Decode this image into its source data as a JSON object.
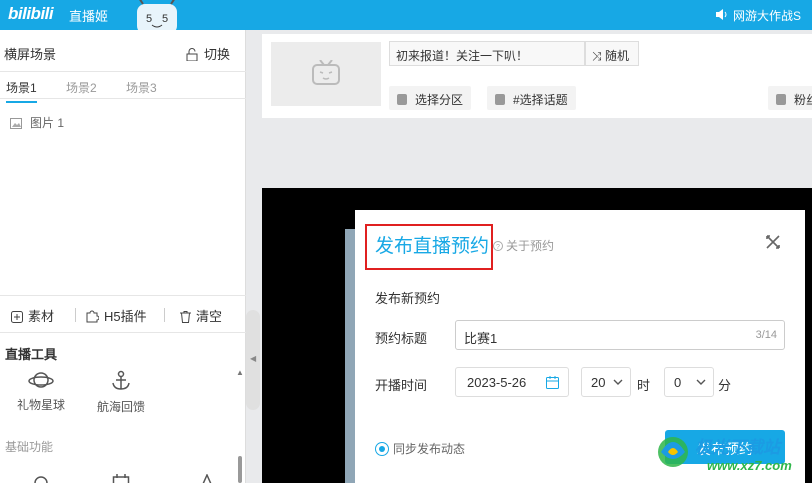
{
  "topbar": {
    "logo": "bilibili",
    "app_name": "直播姬",
    "notice": "网游大作战S"
  },
  "scenes": {
    "title": "横屏场景",
    "switch_label": "切换",
    "tabs": [
      {
        "label": "场景1",
        "active": true
      },
      {
        "label": "场景2",
        "active": false
      },
      {
        "label": "场景3",
        "active": false
      }
    ],
    "sources": [
      {
        "label": "图片 1",
        "icon": "image-icon"
      }
    ]
  },
  "toolbar": {
    "material_label": "素材",
    "h5_label": "H5插件",
    "clear_label": "清空"
  },
  "live_tools": {
    "title": "直播工具",
    "items": [
      {
        "label": "礼物星球",
        "icon": "planet-icon"
      },
      {
        "label": "航海回馈",
        "icon": "anchor-icon"
      }
    ]
  },
  "basic": {
    "title": "基础功能"
  },
  "room_info": {
    "title_text": "初来报道！关注一下叭！",
    "random_label": "随机",
    "select_area_label": "选择分区",
    "select_topic_label": "#选择话题",
    "fans_label": "粉丝"
  },
  "modal": {
    "title": "发布直播预约",
    "help_label": "关于预约",
    "section_label": "发布新预约",
    "title_label": "预约标题",
    "title_value": "比赛1",
    "title_count": "3/14",
    "time_label": "开播时间",
    "date_value": "2023-5-26",
    "hour_value": "20",
    "hour_unit": "时",
    "minute_value": "0",
    "minute_unit": "分",
    "sync_label": "同步发布动态",
    "sync_checked": true,
    "submit_label": "发布预约"
  },
  "watermark": {
    "line1": "极光下载站",
    "line2": "www.xz7.com"
  },
  "colors": {
    "accent": "#17a8e5",
    "highlight_box": "#e02020"
  }
}
